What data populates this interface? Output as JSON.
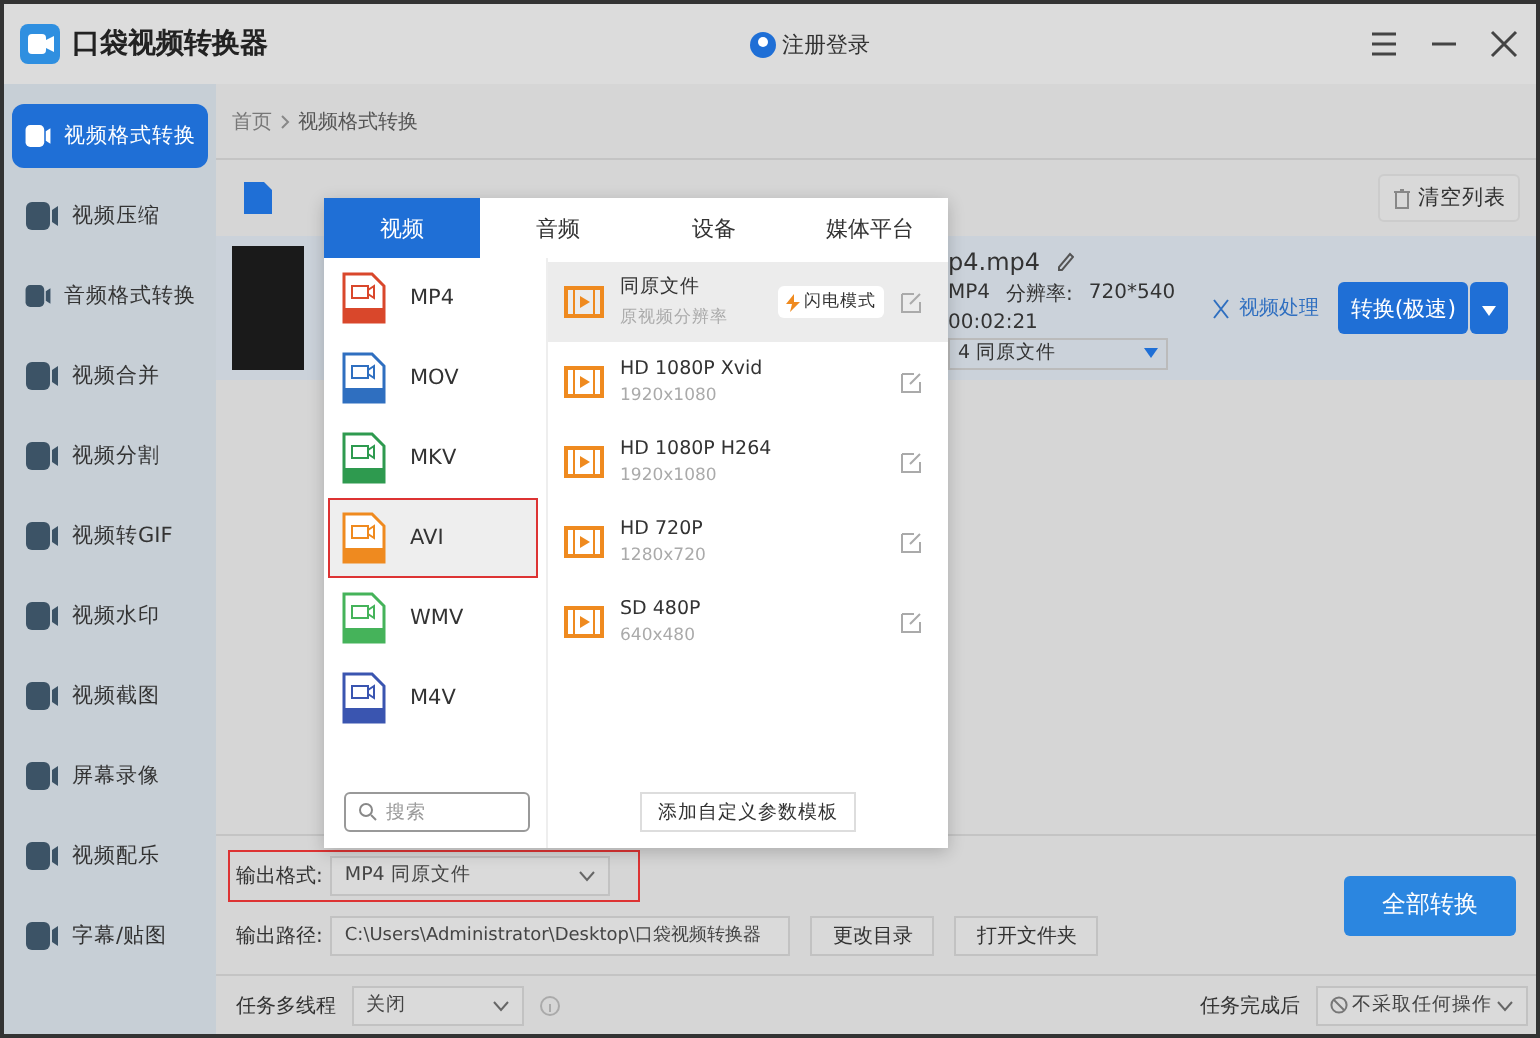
{
  "app": {
    "title": "口袋视频转换器",
    "login": "注册登录"
  },
  "sidebar": {
    "items": [
      {
        "label": "视频格式转换",
        "selected": true
      },
      {
        "label": "视频压缩",
        "selected": false
      },
      {
        "label": "音频格式转换",
        "selected": false
      },
      {
        "label": "视频合并",
        "selected": false
      },
      {
        "label": "视频分割",
        "selected": false
      },
      {
        "label": "视频转GIF",
        "selected": false
      },
      {
        "label": "视频水印",
        "selected": false
      },
      {
        "label": "视频截图",
        "selected": false
      },
      {
        "label": "屏幕录像",
        "selected": false
      },
      {
        "label": "视频配乐",
        "selected": false
      },
      {
        "label": "字幕/贴图",
        "selected": false
      }
    ]
  },
  "breadcrumb": [
    "首页",
    "视频格式转换"
  ],
  "toolbar": {
    "clear_button": "清空列表"
  },
  "file_row": {
    "name": "p4.mp4",
    "format": "MP4",
    "resolution_label": "分辨率:",
    "resolution": "720*540",
    "duration": "00:02:21",
    "output": "4  同原文件",
    "process_link": "视频处理",
    "convert_button": "转换(极速)"
  },
  "format_popup": {
    "tabs": [
      {
        "label": "视频",
        "selected": true
      },
      {
        "label": "音频",
        "selected": false
      },
      {
        "label": "设备",
        "selected": false
      },
      {
        "label": "媒体平台",
        "selected": false
      }
    ],
    "formats": [
      {
        "label": "MP4",
        "color": "#d9472b",
        "selected": false
      },
      {
        "label": "MOV",
        "color": "#2f6fc0",
        "selected": false
      },
      {
        "label": "MKV",
        "color": "#2e9a4f",
        "selected": false
      },
      {
        "label": "AVI",
        "color": "#ef8a1f",
        "selected": true
      },
      {
        "label": "WMV",
        "color": "#45b35a",
        "selected": false
      },
      {
        "label": "M4V",
        "color": "#3a55b0",
        "selected": false
      }
    ],
    "search": {
      "placeholder": "搜索"
    },
    "presets": [
      {
        "name": "同原文件",
        "detail": "原视频分辨率",
        "badge": "闪电模式",
        "selected": true
      },
      {
        "name": "HD 1080P Xvid",
        "detail": "1920x1080",
        "selected": false
      },
      {
        "name": "HD 1080P H264",
        "detail": "1920x1080",
        "selected": false
      },
      {
        "name": "HD 720P",
        "detail": "1280x720",
        "selected": false
      },
      {
        "name": "SD 480P",
        "detail": "640x480",
        "selected": false
      }
    ],
    "custom_button": "添加自定义参数模板"
  },
  "output": {
    "format_label": "输出格式:",
    "format_value": "MP4  同原文件",
    "path_label": "输出路径:",
    "path_value": "C:\\Users\\Administrator\\Desktop\\口袋视频转换器",
    "change_dir": "更改目录",
    "open_folder": "打开文件夹",
    "convert_all": "全部转换"
  },
  "footer": {
    "thread_label": "任务多线程",
    "thread_value": "关闭",
    "after_label": "任务完成后",
    "after_value": "不采取任何操作"
  }
}
